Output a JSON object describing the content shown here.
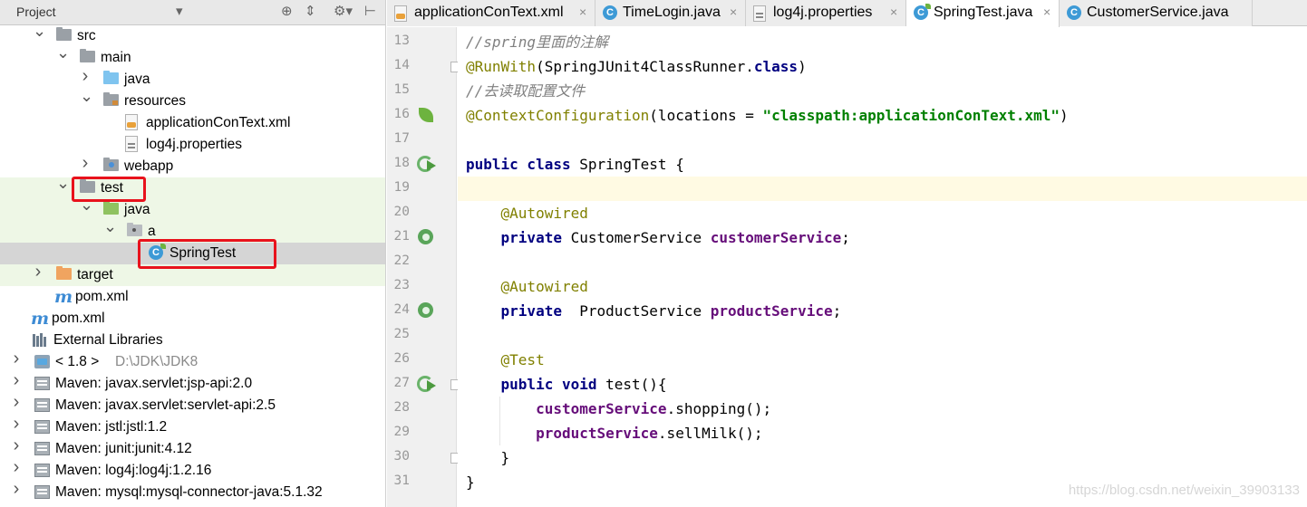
{
  "project_panel": {
    "title": "Project",
    "header_icons": [
      "chevron-down-icon",
      "target-icon",
      "collapse-icon",
      "gear-icon",
      "hide-icon"
    ],
    "tree": [
      {
        "label": "src",
        "icon": "folder-icon",
        "expanded": true
      },
      {
        "label": "main",
        "icon": "folder-icon",
        "expanded": true
      },
      {
        "label": "java",
        "icon": "source-folder-icon",
        "expanded": false
      },
      {
        "label": "resources",
        "icon": "resources-folder-icon",
        "expanded": true
      },
      {
        "label": "applicationConText.xml",
        "icon": "spring-xml-icon"
      },
      {
        "label": "log4j.properties",
        "icon": "properties-file-icon"
      },
      {
        "label": "webapp",
        "icon": "web-folder-icon",
        "expanded": false
      },
      {
        "label": "test",
        "icon": "folder-icon",
        "expanded": true,
        "highlighted": true
      },
      {
        "label": "java",
        "icon": "test-source-folder-icon",
        "expanded": true
      },
      {
        "label": "a",
        "icon": "package-icon",
        "expanded": true
      },
      {
        "label": "SpringTest",
        "icon": "spring-class-icon",
        "selected": true,
        "highlighted": true
      },
      {
        "label": "target",
        "icon": "excluded-folder-icon",
        "expanded": false
      },
      {
        "label": "pom.xml",
        "icon": "maven-icon"
      },
      {
        "label": "pom.xml",
        "icon": "maven-icon"
      },
      {
        "label": "External Libraries",
        "icon": "libraries-icon",
        "expanded": true
      },
      {
        "label": "< 1.8 >",
        "path": "D:\\JDK\\JDK8",
        "icon": "jdk-icon",
        "expanded": false
      },
      {
        "label": "Maven: javax.servlet:jsp-api:2.0",
        "icon": "jar-icon",
        "expanded": false
      },
      {
        "label": "Maven: javax.servlet:servlet-api:2.5",
        "icon": "jar-icon",
        "expanded": false
      },
      {
        "label": "Maven: jstl:jstl:1.2",
        "icon": "jar-icon",
        "expanded": false
      },
      {
        "label": "Maven: junit:junit:4.12",
        "icon": "jar-icon",
        "expanded": false
      },
      {
        "label": "Maven: log4j:log4j:1.2.16",
        "icon": "jar-icon",
        "expanded": false
      },
      {
        "label": "Maven: mysql:mysql-connector-java:5.1.32",
        "icon": "jar-icon",
        "expanded": false
      }
    ]
  },
  "tabs": [
    {
      "label": "applicationConText.xml",
      "icon": "spring-xml-icon",
      "active": false
    },
    {
      "label": "TimeLogin.java",
      "icon": "class-icon",
      "active": false
    },
    {
      "label": "log4j.properties",
      "icon": "properties-file-icon",
      "active": false
    },
    {
      "label": "SpringTest.java",
      "icon": "spring-class-icon",
      "active": true
    },
    {
      "label": "CustomerService.java",
      "icon": "class-icon",
      "active": false
    }
  ],
  "editor": {
    "current_line": 19,
    "lines": [
      {
        "n": "13",
        "segs": [
          {
            "t": "//spring里面的注解",
            "c": "cm"
          }
        ]
      },
      {
        "n": "14",
        "segs": [
          {
            "t": "@RunWith",
            "c": "an"
          },
          {
            "t": "(SpringJUnit4ClassRunner.",
            "c": ""
          },
          {
            "t": "class",
            "c": "kw"
          },
          {
            "t": ")",
            "c": ""
          }
        ]
      },
      {
        "n": "15",
        "segs": [
          {
            "t": "//去读取配置文件",
            "c": "cm"
          }
        ]
      },
      {
        "n": "16",
        "segs": [
          {
            "t": "@ContextConfiguration",
            "c": "an"
          },
          {
            "t": "(locations = ",
            "c": ""
          },
          {
            "t": "\"classpath:applicationConText.xml\"",
            "c": "st"
          },
          {
            "t": ")",
            "c": ""
          }
        ]
      },
      {
        "n": "17",
        "segs": []
      },
      {
        "n": "18",
        "segs": [
          {
            "t": "public class ",
            "c": "kw"
          },
          {
            "t": "SpringTest {",
            "c": ""
          }
        ]
      },
      {
        "n": "19",
        "segs": []
      },
      {
        "n": "20",
        "segs": [
          {
            "t": "    ",
            "c": ""
          },
          {
            "t": "@Autowired",
            "c": "an"
          }
        ]
      },
      {
        "n": "21",
        "segs": [
          {
            "t": "    ",
            "c": ""
          },
          {
            "t": "private ",
            "c": "kw"
          },
          {
            "t": "CustomerService ",
            "c": ""
          },
          {
            "t": "customerService",
            "c": "fd"
          },
          {
            "t": ";",
            "c": ""
          }
        ]
      },
      {
        "n": "22",
        "segs": []
      },
      {
        "n": "23",
        "segs": [
          {
            "t": "    ",
            "c": ""
          },
          {
            "t": "@Autowired",
            "c": "an"
          }
        ]
      },
      {
        "n": "24",
        "segs": [
          {
            "t": "    ",
            "c": ""
          },
          {
            "t": "private  ",
            "c": "kw"
          },
          {
            "t": "ProductService ",
            "c": ""
          },
          {
            "t": "productService",
            "c": "fd"
          },
          {
            "t": ";",
            "c": ""
          }
        ]
      },
      {
        "n": "25",
        "segs": []
      },
      {
        "n": "26",
        "segs": [
          {
            "t": "    ",
            "c": ""
          },
          {
            "t": "@Test",
            "c": "an"
          }
        ]
      },
      {
        "n": "27",
        "segs": [
          {
            "t": "    ",
            "c": ""
          },
          {
            "t": "public void ",
            "c": "kw"
          },
          {
            "t": "test(){",
            "c": ""
          }
        ]
      },
      {
        "n": "28",
        "segs": [
          {
            "t": "        ",
            "c": ""
          },
          {
            "t": "customerService",
            "c": "fd"
          },
          {
            "t": ".shopping();",
            "c": ""
          }
        ]
      },
      {
        "n": "29",
        "segs": [
          {
            "t": "        ",
            "c": ""
          },
          {
            "t": "productService",
            "c": "fd"
          },
          {
            "t": ".sellMilk();",
            "c": ""
          }
        ]
      },
      {
        "n": "30",
        "segs": [
          {
            "t": "    }",
            "c": ""
          }
        ]
      },
      {
        "n": "31",
        "segs": [
          {
            "t": "}",
            "c": ""
          }
        ]
      }
    ],
    "gutter_icons": {
      "16": "spring-leaf-icon",
      "18": "run-icon",
      "21": "bean-icon",
      "24": "bean-icon",
      "27": "run-icon"
    }
  },
  "watermark": "https://blog.csdn.net/weixin_39903133"
}
